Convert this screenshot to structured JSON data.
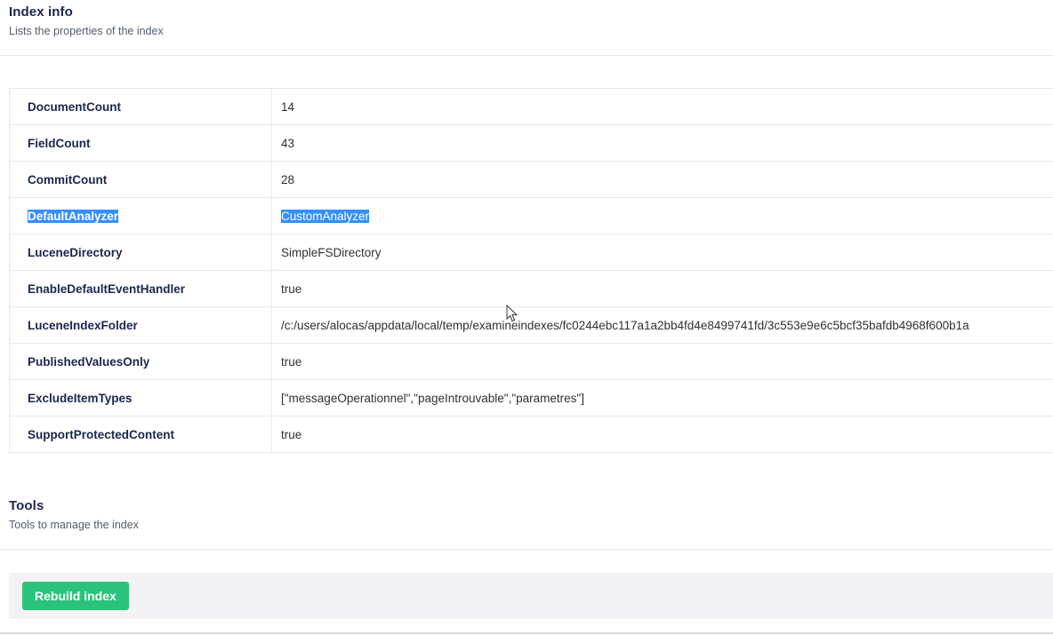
{
  "index_info": {
    "title": "Index info",
    "description": "Lists the properties of the index",
    "properties": [
      {
        "key": "DocumentCount",
        "value": "14"
      },
      {
        "key": "FieldCount",
        "value": "43"
      },
      {
        "key": "CommitCount",
        "value": "28"
      },
      {
        "key": "DefaultAnalyzer",
        "value": "CustomAnalyzer"
      },
      {
        "key": "LuceneDirectory",
        "value": "SimpleFSDirectory"
      },
      {
        "key": "EnableDefaultEventHandler",
        "value": "true"
      },
      {
        "key": "LuceneIndexFolder",
        "value": "/c:/users/alocas/appdata/local/temp/examineindexes/fc0244ebc117a1a2bb4fd4e8499741fd/3c553e9e6c5bcf35bafdb4968f600b1a"
      },
      {
        "key": "PublishedValuesOnly",
        "value": "true"
      },
      {
        "key": "ExcludeItemTypes",
        "value": "[\"messageOperationnel\",\"pageIntrouvable\",\"parametres\"]"
      },
      {
        "key": "SupportProtectedContent",
        "value": "true"
      }
    ]
  },
  "tools": {
    "title": "Tools",
    "description": "Tools to manage the index",
    "rebuild_label": "Rebuild index",
    "rebuild_color": "#2bc37c"
  },
  "selection_color": "#3390ff",
  "cursor_icon": "mouse-pointer-icon"
}
